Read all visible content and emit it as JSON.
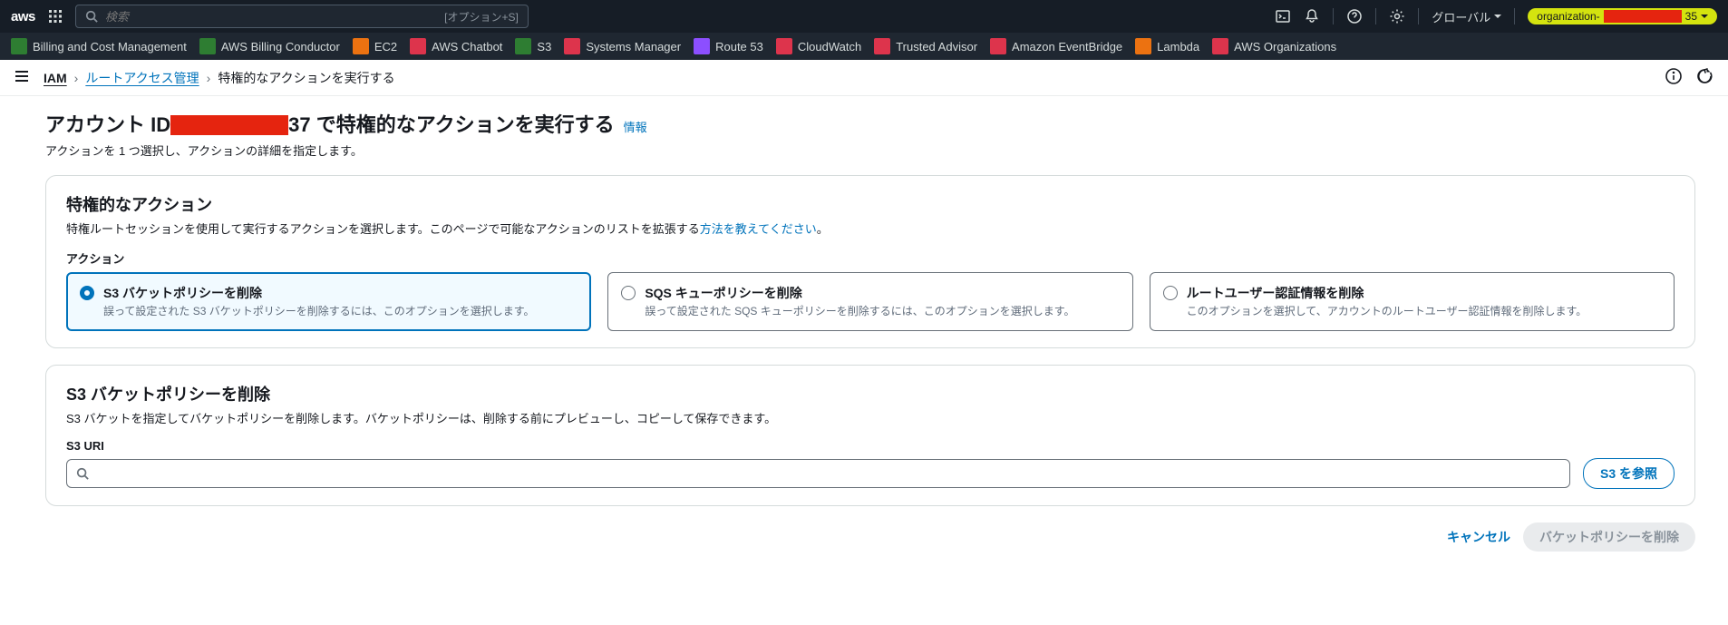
{
  "topnav": {
    "logo": "aws",
    "search_placeholder": "検索",
    "search_hint": "[オプション+S]",
    "region": "グローバル",
    "account_prefix": "organization-",
    "account_suffix": "35"
  },
  "services": [
    {
      "label": "Billing and Cost Management",
      "color": "#2e7d32"
    },
    {
      "label": "AWS Billing Conductor",
      "color": "#2e7d32"
    },
    {
      "label": "EC2",
      "color": "#ec7211"
    },
    {
      "label": "AWS Chatbot",
      "color": "#dd344c"
    },
    {
      "label": "S3",
      "color": "#2e7d32"
    },
    {
      "label": "Systems Manager",
      "color": "#dd344c"
    },
    {
      "label": "Route 53",
      "color": "#8c4fff"
    },
    {
      "label": "CloudWatch",
      "color": "#dd344c"
    },
    {
      "label": "Trusted Advisor",
      "color": "#dd344c"
    },
    {
      "label": "Amazon EventBridge",
      "color": "#dd344c"
    },
    {
      "label": "Lambda",
      "color": "#ec7211"
    },
    {
      "label": "AWS Organizations",
      "color": "#dd344c"
    }
  ],
  "breadcrumb": {
    "iam": "IAM",
    "root_access": "ルートアクセス管理",
    "current": "特権的なアクションを実行する"
  },
  "page": {
    "title_prefix": "アカウント ID",
    "title_suffix": "37 で特権的なアクションを実行する",
    "info": "情報",
    "subtitle": "アクションを 1 つ選択し、アクションの詳細を指定します。"
  },
  "panel1": {
    "title": "特権的なアクション",
    "sub_prefix": "特権ルートセッションを使用して実行するアクションを選択します。このページで可能なアクションのリストを拡張する",
    "sub_link": "方法を教えてください",
    "sub_suffix": "。",
    "label": "アクション",
    "options": [
      {
        "title": "S3 バケットポリシーを削除",
        "desc": "誤って設定された S3 バケットポリシーを削除するには、このオプションを選択します。"
      },
      {
        "title": "SQS キューポリシーを削除",
        "desc": "誤って設定された SQS キューポリシーを削除するには、このオプションを選択します。"
      },
      {
        "title": "ルートユーザー認証情報を削除",
        "desc": "このオプションを選択して、アカウントのルートユーザー認証情報を削除します。"
      }
    ]
  },
  "panel2": {
    "title": "S3 バケットポリシーを削除",
    "sub": "S3 バケットを指定してバケットポリシーを削除します。バケットポリシーは、削除する前にプレビューし、コピーして保存できます。",
    "label": "S3 URI",
    "input_value": "",
    "browse": "S3 を参照"
  },
  "footer": {
    "cancel": "キャンセル",
    "submit": "バケットポリシーを削除"
  }
}
